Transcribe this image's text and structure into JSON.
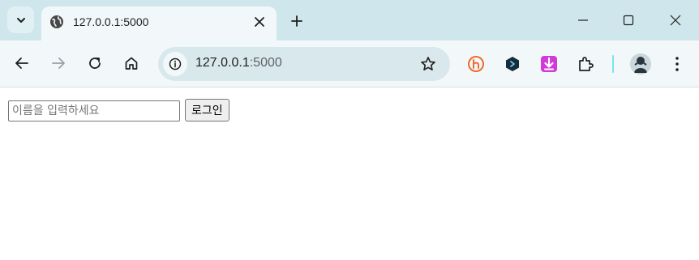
{
  "browser": {
    "tab": {
      "title": "127.0.0.1:5000"
    },
    "address_bar": {
      "host": "127.0.0.1",
      "port": ":5000"
    },
    "colors": {
      "frame": "#cfe6ec",
      "toolbar": "#f2f8fa",
      "omnibox": "#d9e8ec"
    },
    "icons": {
      "tab_search": "chevron-down-icon",
      "favicon": "globe-icon",
      "tab_close": "close-icon",
      "new_tab": "plus-icon",
      "back": "arrow-left-icon",
      "forward": "arrow-right-icon",
      "reload": "reload-icon",
      "home": "home-icon",
      "site_info": "info-icon",
      "bookmark": "star-icon",
      "extensions": [
        "hypothesis-extension-icon",
        "dark-hexagon-extension-icon",
        "download-extension-icon",
        "puzzle-icon"
      ],
      "profile": "profile-avatar-icon",
      "menu": "kebab-menu-icon"
    }
  },
  "page": {
    "name_input": {
      "placeholder": "이름을 입력하세요",
      "value": ""
    },
    "login_button": {
      "label": "로그인"
    }
  }
}
